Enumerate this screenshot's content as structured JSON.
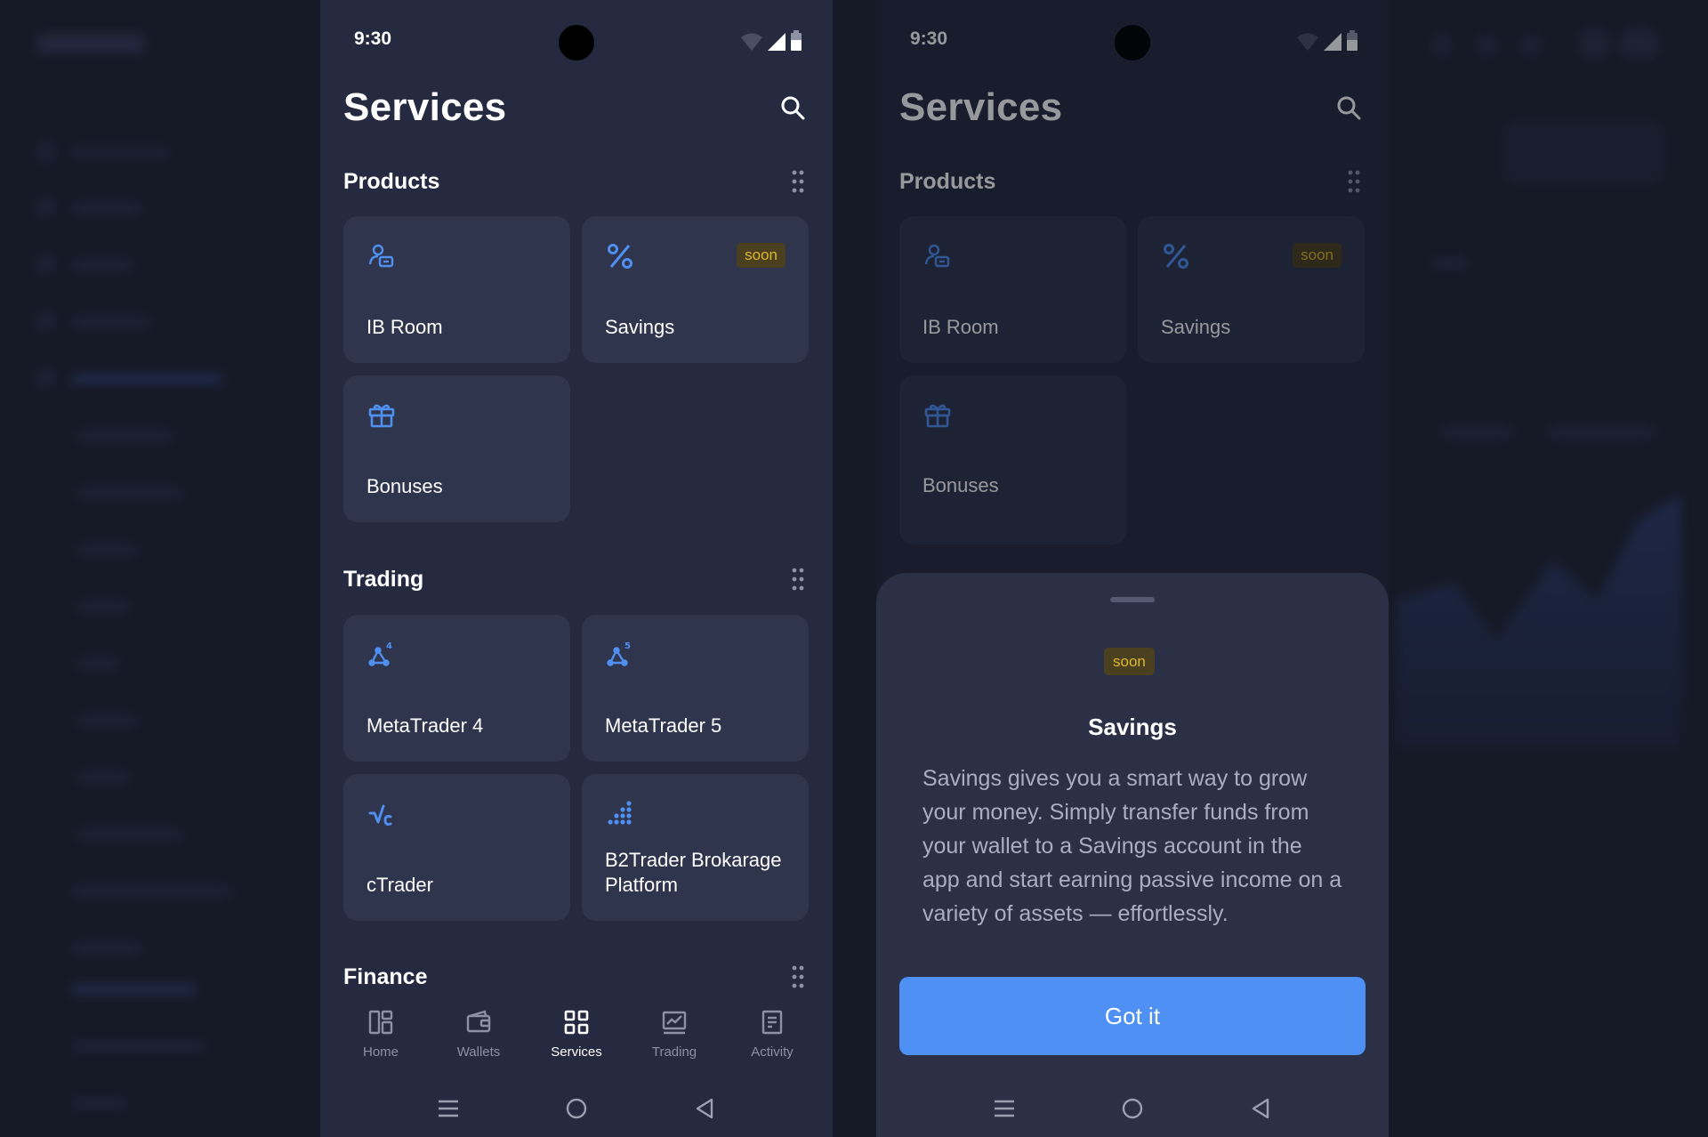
{
  "status": {
    "time": "9:30"
  },
  "screen": {
    "title": "Services"
  },
  "sections": {
    "products": {
      "title": "Products"
    },
    "trading": {
      "title": "Trading"
    },
    "finance": {
      "title": "Finance"
    }
  },
  "cards": {
    "ib_room": {
      "label": "IB Room",
      "icon": "ib-room-icon"
    },
    "savings": {
      "label": "Savings",
      "icon": "percent-icon",
      "badge": "soon"
    },
    "bonuses": {
      "label": "Bonuses",
      "icon": "gift-icon"
    },
    "mt4": {
      "label": "MetaTrader 4",
      "icon": "metatrader-4-icon"
    },
    "mt5": {
      "label": "MetaTrader 5",
      "icon": "metatrader-5-icon"
    },
    "ctrader": {
      "label": "cTrader",
      "icon": "ctrader-icon"
    },
    "b2trader": {
      "label": "B2Trader Brokarage Platform",
      "icon": "b2trader-icon"
    }
  },
  "nav": {
    "home": "Home",
    "wallets": "Wallets",
    "services": "Services",
    "trading": "Trading",
    "activity": "Activity",
    "active": "Services"
  },
  "sheet": {
    "badge": "soon",
    "title": "Savings",
    "body": "Savings gives you a smart way to grow your money. Simply transfer funds from your wallet to a Savings account in the app and start earning passive income on a variety of assets — effortlessly.",
    "button": "Got it"
  },
  "colors": {
    "accent": "#4e90f3",
    "icon_blue": "#4e8ff0",
    "card_bg": "#30354e",
    "phone_bg": "#262a40",
    "soon_text": "#e0b62a",
    "soon_bg": "#4a4020"
  }
}
